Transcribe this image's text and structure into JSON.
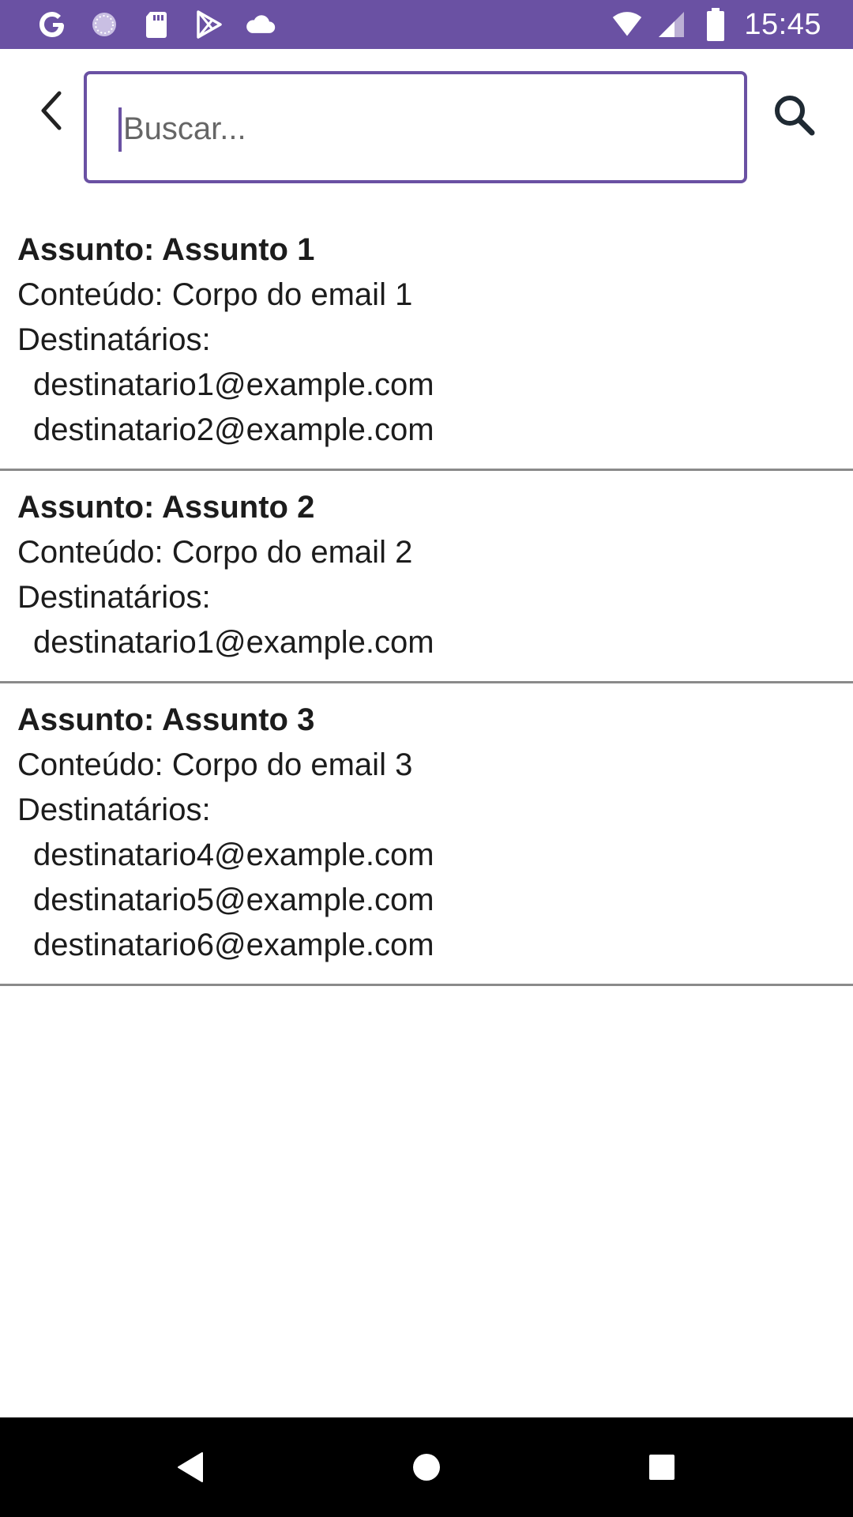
{
  "status_bar": {
    "time": "15:45",
    "left_icons": [
      "google-icon",
      "loading-circle-icon",
      "sd-card-icon",
      "play-store-icon",
      "cloud-icon"
    ],
    "right_icons": [
      "wifi-icon",
      "signal-icon",
      "battery-icon"
    ],
    "color": "#6a51a3"
  },
  "search": {
    "placeholder": "Buscar...",
    "value": "",
    "accent": "#6a51a3"
  },
  "emails": [
    {
      "subject": "Assunto: Assunto 1",
      "content": "Conteúdo: Corpo do email 1",
      "recipients_label": "Destinatários:",
      "recipients": [
        "destinatario1@example.com",
        "destinatario2@example.com"
      ]
    },
    {
      "subject": "Assunto: Assunto 2",
      "content": "Conteúdo: Corpo do email 2",
      "recipients_label": "Destinatários:",
      "recipients": [
        "destinatario1@example.com"
      ]
    },
    {
      "subject": "Assunto: Assunto 3",
      "content": "Conteúdo: Corpo do email 3",
      "recipients_label": "Destinatários:",
      "recipients": [
        "destinatario4@example.com",
        "destinatario5@example.com",
        "destinatario6@example.com"
      ]
    }
  ],
  "nav_bar": {
    "buttons": [
      "back-triangle-icon",
      "home-circle-icon",
      "recents-square-icon"
    ]
  }
}
